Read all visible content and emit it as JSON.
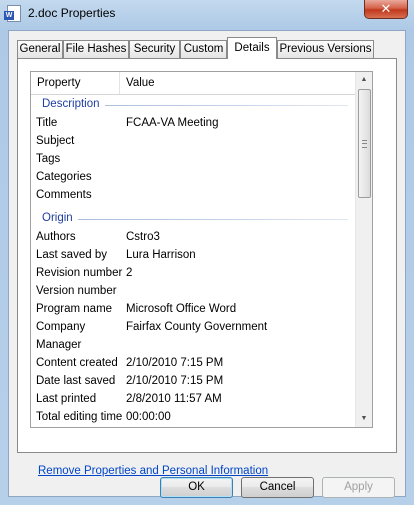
{
  "window": {
    "title": "2.doc Properties",
    "close_glyph": "✕",
    "icon": "word-document-icon"
  },
  "tabs": [
    {
      "label": "General"
    },
    {
      "label": "File Hashes"
    },
    {
      "label": "Security"
    },
    {
      "label": "Custom"
    },
    {
      "label": "Details",
      "active": true
    },
    {
      "label": "Previous Versions"
    }
  ],
  "list": {
    "headers": {
      "property": "Property",
      "value": "Value"
    },
    "groups": {
      "description": "Description",
      "origin": "Origin"
    },
    "description_rows": [
      {
        "key": "Title",
        "value": "FCAA-VA Meeting"
      },
      {
        "key": "Subject",
        "value": ""
      },
      {
        "key": "Tags",
        "value": ""
      },
      {
        "key": "Categories",
        "value": ""
      },
      {
        "key": "Comments",
        "value": ""
      }
    ],
    "origin_rows": [
      {
        "key": "Authors",
        "value": "Cstro3"
      },
      {
        "key": "Last saved by",
        "value": "Lura Harrison"
      },
      {
        "key": "Revision number",
        "value": "2"
      },
      {
        "key": "Version number",
        "value": ""
      },
      {
        "key": "Program name",
        "value": "Microsoft Office Word"
      },
      {
        "key": "Company",
        "value": "Fairfax County Government"
      },
      {
        "key": "Manager",
        "value": ""
      },
      {
        "key": "Content created",
        "value": "2/10/2010 7:15 PM"
      },
      {
        "key": "Date last saved",
        "value": "2/10/2010 7:15 PM"
      },
      {
        "key": "Last printed",
        "value": "2/8/2010 11:57 AM"
      },
      {
        "key": "Total editing time",
        "value": "00:00:00"
      }
    ]
  },
  "scrollbar": {
    "up_glyph": "▲",
    "down_glyph": "▼"
  },
  "link": {
    "remove": "Remove Properties and Personal Information"
  },
  "buttons": {
    "ok": "OK",
    "cancel": "Cancel",
    "apply": "Apply"
  },
  "colors": {
    "group_header": "#1e3ea0",
    "link": "#0045c8"
  }
}
